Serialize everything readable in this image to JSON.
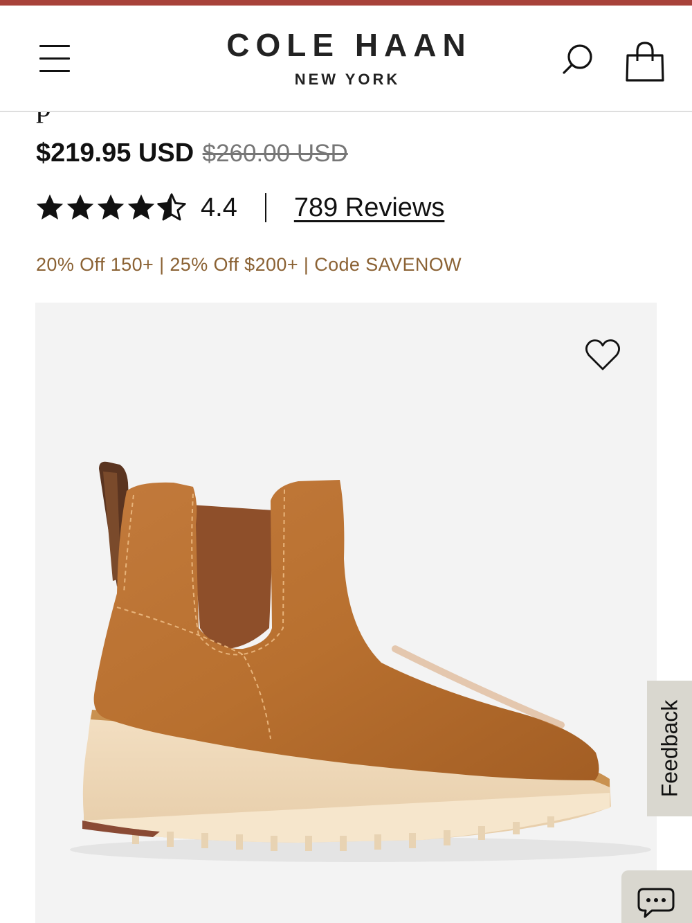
{
  "brand": {
    "name": "COLE HAAN",
    "tagline": "NEW YORK"
  },
  "header": {
    "menu_icon": "hamburger-menu-icon",
    "search_icon": "search-icon",
    "bag_icon": "shopping-bag-icon",
    "accent_color": "#a8423a"
  },
  "product": {
    "title_fragment": "p",
    "price": "$219.95 USD",
    "original_price": "$260.00 USD",
    "rating": {
      "stars": 4.5,
      "value": "4.4",
      "reviews_label": "789 Reviews"
    },
    "promo": "20% Off 150+ | 25% Off $200+ | Code SAVENOW",
    "promo_color": "#8b6234",
    "image_alt": "Tan leather Chelsea wedge boot",
    "wishlist_icon": "heart-icon"
  },
  "feedback": {
    "label": "Feedback"
  },
  "chat": {
    "icon": "chat-bubble-icon"
  }
}
